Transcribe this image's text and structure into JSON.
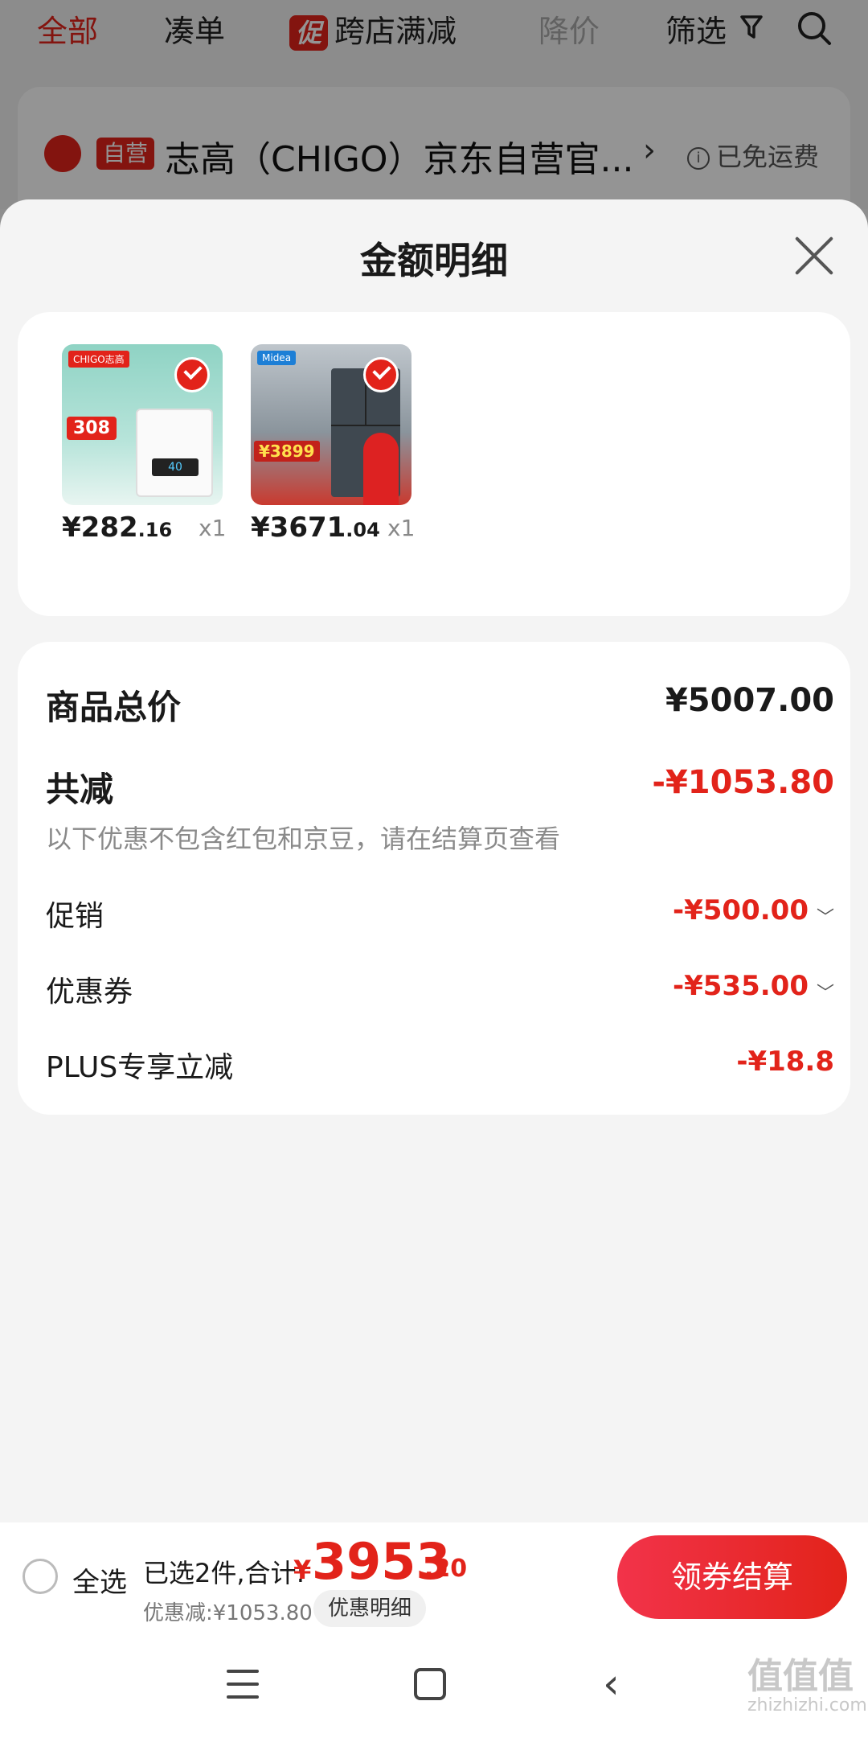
{
  "top_tabs": {
    "all": "全部",
    "bundle": "凑单",
    "promo_badge": "促",
    "cross_store": "跨店满减",
    "price_drop": "降价",
    "filter": "筛选"
  },
  "shop": {
    "badge": "自营",
    "name": "志高（CHIGO）京东自营官...",
    "arrow": "›",
    "free_shipping": "已免运费",
    "info_glyph": "i"
  },
  "sheet": {
    "title": "金额明细"
  },
  "products": [
    {
      "price_int": "¥282",
      "price_dec": ".16",
      "qty": "x1",
      "img_brand": "CHIGO志高",
      "img_price": "308",
      "img_screen": "40"
    },
    {
      "price_int": "¥3671",
      "price_dec": ".04",
      "qty": "x1",
      "img_brand": "Midea",
      "img_price": "¥3899"
    }
  ],
  "summary": {
    "total_label": "商品总价",
    "total_value": "¥5007.00",
    "reduce_label": "共减",
    "reduce_value": "-¥1053.80",
    "reduce_note": "以下优惠不包含红包和京豆，请在结算页查看",
    "items": [
      {
        "label": "促销",
        "value": "-¥500.00",
        "expandable": true
      },
      {
        "label": "优惠券",
        "value": "-¥535.00",
        "expandable": true
      },
      {
        "label": "PLUS专享立减",
        "value": "-¥18.8",
        "expandable": false
      }
    ]
  },
  "bottom_bar": {
    "select_all": "全选",
    "selected_text": "已选2件,合计:",
    "yen": "¥",
    "total_int": "3953",
    "total_dec": ".20",
    "discount_text": "优惠减:¥1053.80",
    "detail_button": "优惠明细",
    "checkout_button": "领券结算"
  },
  "watermark": {
    "main": "值值值",
    "sub": "zhizhizhi.com"
  },
  "colors": {
    "accent": "#e2231a",
    "background": "#f4f4f4"
  }
}
